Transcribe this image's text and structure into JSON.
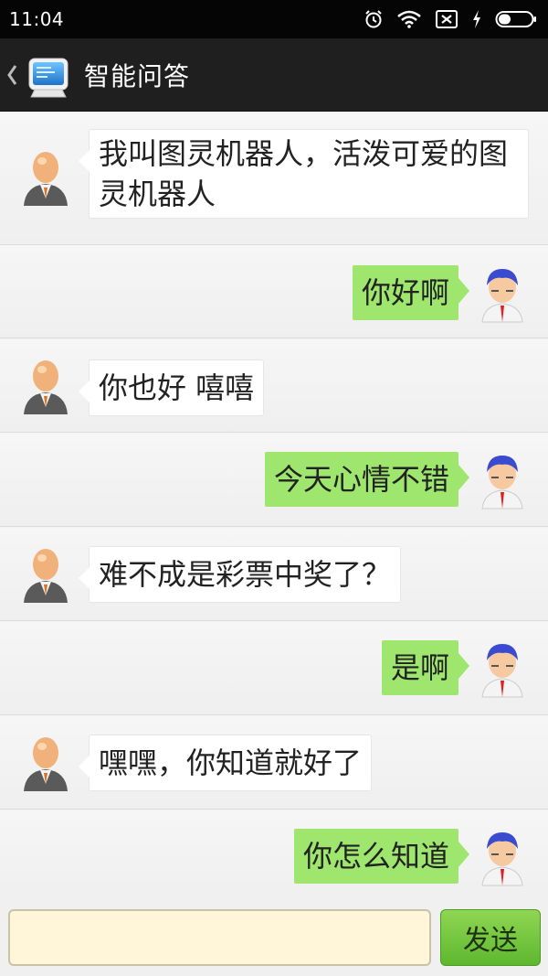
{
  "status_bar": {
    "time": "11:04",
    "icons": [
      "alarm-icon",
      "wifi-icon",
      "sim-disabled-icon",
      "charging-icon",
      "battery-icon"
    ]
  },
  "action_bar": {
    "title": "智能问答",
    "icons": [
      "back-chevron-icon",
      "app-computer-icon"
    ]
  },
  "messages": [
    {
      "from": "bot",
      "text": "我叫图灵机器人，活泼可爱的图灵机器人"
    },
    {
      "from": "me",
      "text": "你好啊"
    },
    {
      "from": "bot",
      "text": "你也好 嘻嘻"
    },
    {
      "from": "me",
      "text": "今天心情不错"
    },
    {
      "from": "bot",
      "text": "难不成是彩票中奖了？"
    },
    {
      "from": "me",
      "text": "是啊"
    },
    {
      "from": "bot",
      "text": "嘿嘿，你知道就好了"
    },
    {
      "from": "me",
      "text": "你怎么知道"
    }
  ],
  "input_bar": {
    "value": "",
    "placeholder": "",
    "send_label": "发送"
  },
  "colors": {
    "me_bubble": "#9ee66d",
    "bot_bubble": "#ffffff",
    "input_bg": "#fff5d8",
    "send_button": "#6cc43a"
  }
}
